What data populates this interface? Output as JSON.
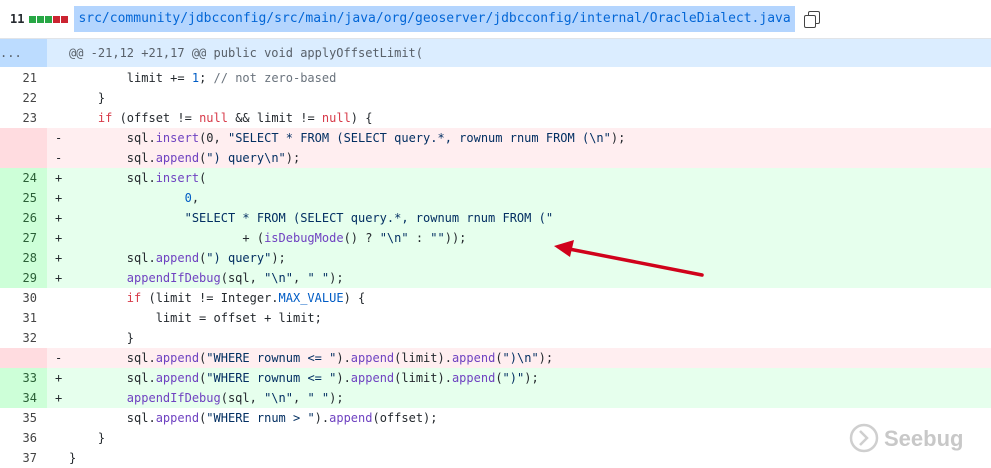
{
  "file_header": {
    "change_count": "11",
    "stat_colors": [
      "#28a745",
      "#28a745",
      "#28a745",
      "#cb2431",
      "#cb2431"
    ],
    "path": "src/community/jdbcconfig/src/main/java/org/geoserver/jdbcconfig/internal/OracleDialect.java",
    "copy_icon": "copy-icon"
  },
  "hunk": {
    "expand_marker": "...",
    "header": "@@ -21,12 +21,17 @@ public void applyOffsetLimit("
  },
  "lines": [
    {
      "num": "21",
      "sign": "",
      "type": "ctx"
    },
    {
      "num": "22",
      "sign": "",
      "type": "ctx"
    },
    {
      "num": "23",
      "sign": "",
      "type": "ctx"
    },
    {
      "num": "",
      "sign": "-",
      "type": "del"
    },
    {
      "num": "",
      "sign": "-",
      "type": "del"
    },
    {
      "num": "24",
      "sign": "+",
      "type": "add"
    },
    {
      "num": "25",
      "sign": "+",
      "type": "add"
    },
    {
      "num": "26",
      "sign": "+",
      "type": "add"
    },
    {
      "num": "27",
      "sign": "+",
      "type": "add"
    },
    {
      "num": "28",
      "sign": "+",
      "type": "add"
    },
    {
      "num": "29",
      "sign": "+",
      "type": "add"
    },
    {
      "num": "30",
      "sign": "",
      "type": "ctx"
    },
    {
      "num": "31",
      "sign": "",
      "type": "ctx"
    },
    {
      "num": "32",
      "sign": "",
      "type": "ctx"
    },
    {
      "num": "",
      "sign": "-",
      "type": "del"
    },
    {
      "num": "33",
      "sign": "+",
      "type": "add"
    },
    {
      "num": "34",
      "sign": "+",
      "type": "add"
    },
    {
      "num": "35",
      "sign": "",
      "type": "ctx"
    },
    {
      "num": "36",
      "sign": "",
      "type": "ctx"
    },
    {
      "num": "37",
      "sign": "",
      "type": "ctx"
    }
  ],
  "code": {
    "l0": [
      "        limit += ",
      "1",
      "; ",
      "// not zero-based"
    ],
    "l1": [
      "    }"
    ],
    "l2": [
      "    ",
      "if",
      " (offset != ",
      "null",
      " && limit != ",
      "null",
      ") {"
    ],
    "l3": [
      "        sql.",
      "insert",
      "(0, ",
      "\"SELECT * FROM (SELECT query.*, rownum rnum FROM (\\n\"",
      ");"
    ],
    "l4": [
      "        sql.",
      "append",
      "(",
      "\") query\\n\"",
      ");"
    ],
    "l5": [
      "        sql.",
      "insert",
      "("
    ],
    "l6": [
      "                ",
      "0",
      ","
    ],
    "l7": [
      "                ",
      "\"SELECT * FROM (SELECT query.*, rownum rnum FROM (\""
    ],
    "l8": [
      "                        + (",
      "isDebugMode",
      "() ? ",
      "\"\\n\"",
      " : ",
      "\"\"",
      "));"
    ],
    "l9": [
      "        sql.",
      "append",
      "(",
      "\") query\"",
      ");"
    ],
    "l10": [
      "        ",
      "appendIfDebug",
      "(sql, ",
      "\"\\n\"",
      ", ",
      "\" \"",
      ");"
    ],
    "l11": [
      "        ",
      "if",
      " (limit != Integer.",
      "MAX_VALUE",
      ") {"
    ],
    "l12": [
      "            limit = offset + limit;"
    ],
    "l13": [
      "        }"
    ],
    "l14": [
      "        sql.",
      "append",
      "(",
      "\"WHERE rownum <= \"",
      ").",
      "append",
      "(limit).",
      "append",
      "(",
      "\")\\n\"",
      ");"
    ],
    "l15": [
      "        sql.",
      "append",
      "(",
      "\"WHERE rownum <= \"",
      ").",
      "append",
      "(limit).",
      "append",
      "(",
      "\")\"",
      ");"
    ],
    "l16": [
      "        ",
      "appendIfDebug",
      "(sql, ",
      "\"\\n\"",
      ", ",
      "\" \"",
      ");"
    ],
    "l17": [
      "        sql.",
      "append",
      "(",
      "\"WHERE rnum > \"",
      ").",
      "append",
      "(offset);"
    ],
    "l18": [
      "    }"
    ],
    "l19": [
      "}"
    ]
  },
  "annotation": {
    "arrow_color": "#d0021b"
  },
  "watermark": {
    "text": "Seebug"
  }
}
